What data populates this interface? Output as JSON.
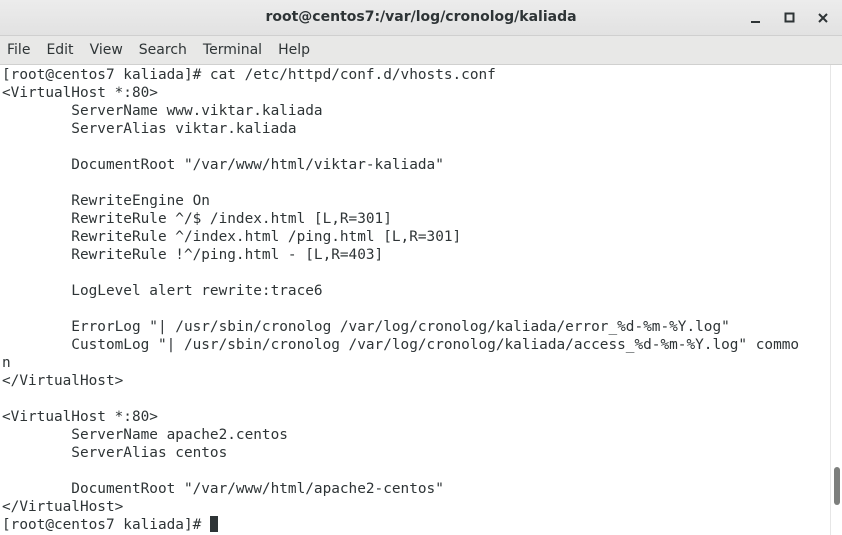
{
  "window": {
    "title": "root@centos7:/var/log/cronolog/kaliada",
    "controls": [
      "minimize-icon",
      "maximize-icon",
      "close-icon"
    ]
  },
  "menubar": {
    "items": [
      "File",
      "Edit",
      "View",
      "Search",
      "Terminal",
      "Help"
    ]
  },
  "terminal": {
    "lines": [
      "[root@centos7 kaliada]# cat /etc/httpd/conf.d/vhosts.conf",
      "<VirtualHost *:80>",
      "        ServerName www.viktar.kaliada",
      "        ServerAlias viktar.kaliada",
      "",
      "        DocumentRoot \"/var/www/html/viktar-kaliada\"",
      "",
      "        RewriteEngine On",
      "        RewriteRule ^/$ /index.html [L,R=301]",
      "        RewriteRule ^/index.html /ping.html [L,R=301]",
      "        RewriteRule !^/ping.html - [L,R=403]",
      "",
      "        LogLevel alert rewrite:trace6",
      "",
      "        ErrorLog \"| /usr/sbin/cronolog /var/log/cronolog/kaliada/error_%d-%m-%Y.log\"",
      "        CustomLog \"| /usr/sbin/cronolog /var/log/cronolog/kaliada/access_%d-%m-%Y.log\" commo",
      "n",
      "</VirtualHost>",
      "",
      "<VirtualHost *:80>",
      "        ServerName apache2.centos",
      "        ServerAlias centos",
      "",
      "        DocumentRoot \"/var/www/html/apache2-centos\"",
      "</VirtualHost>",
      "[root@centos7 kaliada]# "
    ],
    "scroll_position": 0.93,
    "scroll_visible_fraction": 0.08
  },
  "colors": {
    "text": "#2e3436",
    "background": "#ffffff",
    "titlebar": "#e4e4e4",
    "menubar": "#e8e8e7",
    "scroll_thumb": "#7d7f7d"
  }
}
